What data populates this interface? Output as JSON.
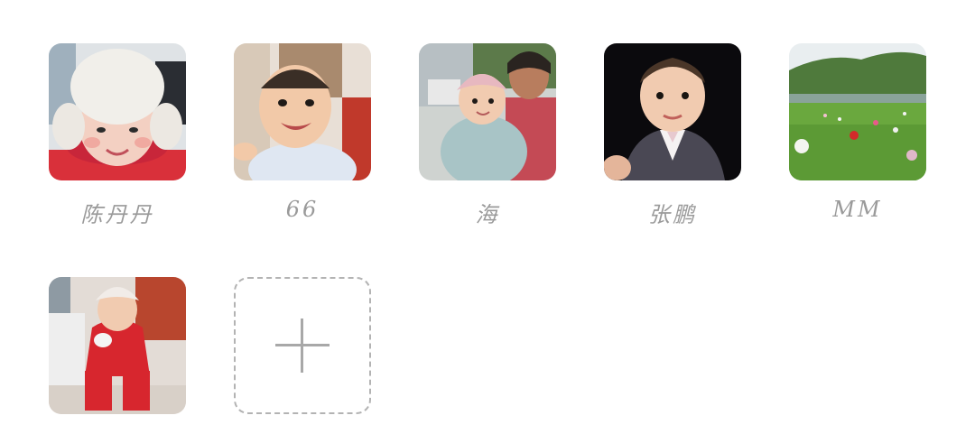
{
  "contacts": [
    {
      "name": "陈丹丹",
      "photo": "child-white-hat-red-jacket-photo"
    },
    {
      "name": "66",
      "photo": "smiling-baby-photo"
    },
    {
      "name": "海",
      "photo": "woman-holding-baby-photo"
    },
    {
      "name": "张鹏",
      "photo": "baby-in-suit-photo"
    },
    {
      "name": "MM",
      "photo": "flower-meadow-landscape-photo"
    },
    {
      "name": "",
      "photo": "toddler-red-outfit-photo"
    }
  ],
  "add_button": {
    "icon": "plus-icon"
  },
  "colors": {
    "label": "#9a9a9a",
    "dashed_border": "#b3b3b3",
    "plus": "#a8a8a8"
  }
}
